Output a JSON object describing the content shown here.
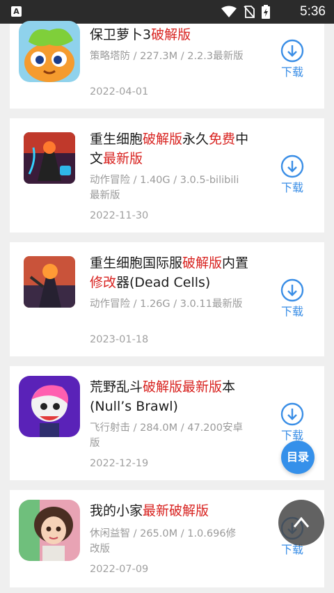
{
  "status": {
    "time": "5:36",
    "app_icon_letter": "A",
    "icons": [
      "wifi-icon",
      "no-sim-icon",
      "battery-charging-icon"
    ]
  },
  "colors": {
    "accent": "#3a8ee6",
    "highlight": "#d8221f",
    "muted": "#9a9a9a"
  },
  "download_label": "下载",
  "toc_label": "目录",
  "items": [
    {
      "title_parts": [
        [
          "保卫萝卜3",
          ""
        ],
        [
          "破解版",
          "red"
        ]
      ],
      "meta": "策略塔防 / 227.3M / 2.2.3最新版",
      "date": "2022-04-01"
    },
    {
      "title_parts": [
        [
          "重生细胞",
          ""
        ],
        [
          "破解版",
          "red"
        ],
        [
          "永久",
          ""
        ],
        [
          "免费",
          "red"
        ],
        [
          "中文",
          ""
        ],
        [
          "最新版",
          "red"
        ]
      ],
      "meta": "动作冒险 / 1.40G / 3.0.5-bilibili最新版",
      "date": "2022-11-30"
    },
    {
      "title_parts": [
        [
          "重生细胞国际服",
          ""
        ],
        [
          "破解版",
          "red"
        ],
        [
          "内置",
          ""
        ],
        [
          "修改",
          "red"
        ],
        [
          "器(Dead Cells)",
          ""
        ]
      ],
      "meta": "动作冒险 / 1.26G / 3.0.11最新版",
      "date": "2023-01-18"
    },
    {
      "title_parts": [
        [
          "荒野乱斗",
          ""
        ],
        [
          "破解版",
          "red"
        ],
        [
          "最新版",
          "red"
        ],
        [
          "本(Null’s Brawl)",
          ""
        ]
      ],
      "meta": "飞行射击 / 284.0M / 47.200安卓版",
      "date": "2022-12-19"
    },
    {
      "title_parts": [
        [
          "我的小家",
          ""
        ],
        [
          "最新破解版",
          "red"
        ]
      ],
      "meta": "休闲益智 / 265.0M / 1.0.696修改版",
      "date": "2022-07-09"
    }
  ]
}
